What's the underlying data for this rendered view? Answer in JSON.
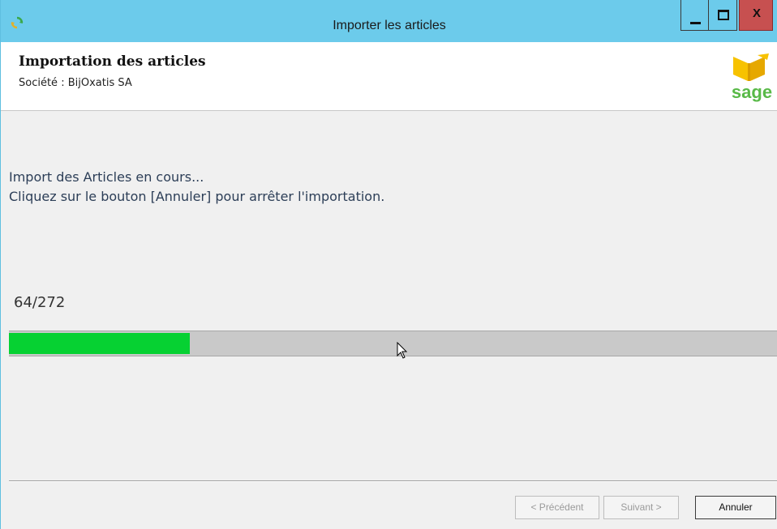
{
  "window": {
    "title": "Importer les articles",
    "close_label": "X"
  },
  "header": {
    "title": "Importation des articles",
    "subtitle": "Société : BijOxatis SA",
    "logo_text": "sage"
  },
  "status": {
    "line1": "Import des Articles en cours...",
    "line2": "Cliquez sur le bouton [Annuler] pour arrêter l'importation."
  },
  "progress": {
    "current": 64,
    "total": 272,
    "label": "64/272",
    "fill_color": "#06d132"
  },
  "buttons": {
    "prev": "< Précédent",
    "next": "Suivant >",
    "cancel": "Annuler"
  },
  "colors": {
    "titlebar": "#6ccbeb",
    "close": "#c75050",
    "sage_green": "#58b947",
    "sage_yellow": "#f7c200"
  },
  "icons": {
    "app": "refresh-icon",
    "cursor": "mouse-pointer-icon",
    "logo": "sage-box-logo"
  }
}
